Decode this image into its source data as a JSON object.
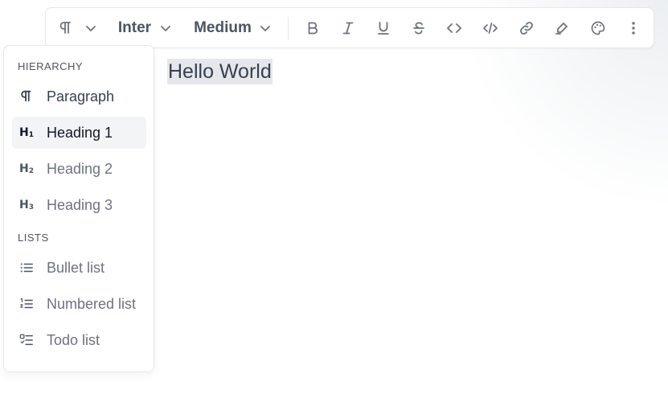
{
  "toolbar": {
    "block_type_icon": "pilcrow-icon",
    "font_family": "Inter",
    "font_weight": "Medium",
    "buttons": [
      {
        "name": "bold-icon"
      },
      {
        "name": "italic-icon"
      },
      {
        "name": "underline-icon"
      },
      {
        "name": "strikethrough-icon"
      },
      {
        "name": "code-icon"
      },
      {
        "name": "code-block-icon"
      },
      {
        "name": "link-icon"
      },
      {
        "name": "highlight-icon"
      },
      {
        "name": "palette-icon"
      },
      {
        "name": "more-vertical-icon"
      }
    ]
  },
  "editor": {
    "text": "Hello World"
  },
  "menu": {
    "sections": [
      {
        "title": "HIERARCHY",
        "items": [
          {
            "label": "Paragraph",
            "icon": "pilcrow-icon"
          },
          {
            "label": "Heading 1",
            "icon": "heading-1-icon",
            "icon_text": "H",
            "icon_sub": "1",
            "active": true
          },
          {
            "label": "Heading 2",
            "icon": "heading-2-icon",
            "icon_text": "H",
            "icon_sub": "2"
          },
          {
            "label": "Heading 3",
            "icon": "heading-3-icon",
            "icon_text": "H",
            "icon_sub": "3"
          }
        ]
      },
      {
        "title": "LISTS",
        "items": [
          {
            "label": "Bullet list",
            "icon": "bullet-list-icon"
          },
          {
            "label": "Numbered list",
            "icon": "numbered-list-icon"
          },
          {
            "label": "Todo list",
            "icon": "todo-list-icon"
          }
        ]
      }
    ]
  },
  "colors": {
    "border": "#e5e7eb",
    "active_bg": "#f3f4f6",
    "selection_bg": "#e5e7eb",
    "icon": "#6b7280"
  }
}
